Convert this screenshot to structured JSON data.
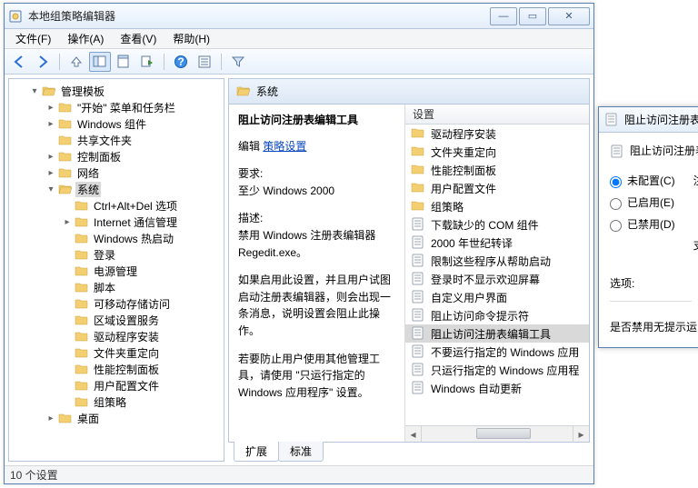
{
  "window": {
    "title": "本地组策略编辑器"
  },
  "menu": {
    "file": "文件(F)",
    "action": "操作(A)",
    "view": "查看(V)",
    "help": "帮助(H)"
  },
  "tree": [
    {
      "depth": 0,
      "toggle": "▾",
      "open": true,
      "label": "管理模板",
      "selected": false
    },
    {
      "depth": 1,
      "toggle": "▸",
      "open": false,
      "label": "\"开始\" 菜单和任务栏",
      "selected": false
    },
    {
      "depth": 1,
      "toggle": "▸",
      "open": false,
      "label": "Windows 组件",
      "selected": false
    },
    {
      "depth": 1,
      "toggle": "",
      "open": false,
      "label": "共享文件夹",
      "selected": false
    },
    {
      "depth": 1,
      "toggle": "▸",
      "open": false,
      "label": "控制面板",
      "selected": false
    },
    {
      "depth": 1,
      "toggle": "▸",
      "open": false,
      "label": "网络",
      "selected": false
    },
    {
      "depth": 1,
      "toggle": "▾",
      "open": true,
      "label": "系统",
      "selected": true
    },
    {
      "depth": 2,
      "toggle": "",
      "open": false,
      "label": "Ctrl+Alt+Del 选项",
      "selected": false
    },
    {
      "depth": 2,
      "toggle": "▸",
      "open": false,
      "label": "Internet 通信管理",
      "selected": false
    },
    {
      "depth": 2,
      "toggle": "",
      "open": false,
      "label": "Windows 热启动",
      "selected": false
    },
    {
      "depth": 2,
      "toggle": "",
      "open": false,
      "label": "登录",
      "selected": false
    },
    {
      "depth": 2,
      "toggle": "",
      "open": false,
      "label": "电源管理",
      "selected": false
    },
    {
      "depth": 2,
      "toggle": "",
      "open": false,
      "label": "脚本",
      "selected": false
    },
    {
      "depth": 2,
      "toggle": "",
      "open": false,
      "label": "可移动存储访问",
      "selected": false
    },
    {
      "depth": 2,
      "toggle": "",
      "open": false,
      "label": "区域设置服务",
      "selected": false
    },
    {
      "depth": 2,
      "toggle": "",
      "open": false,
      "label": "驱动程序安装",
      "selected": false
    },
    {
      "depth": 2,
      "toggle": "",
      "open": false,
      "label": "文件夹重定向",
      "selected": false
    },
    {
      "depth": 2,
      "toggle": "",
      "open": false,
      "label": "性能控制面板",
      "selected": false
    },
    {
      "depth": 2,
      "toggle": "",
      "open": false,
      "label": "用户配置文件",
      "selected": false
    },
    {
      "depth": 2,
      "toggle": "",
      "open": false,
      "label": "组策略",
      "selected": false
    },
    {
      "depth": 1,
      "toggle": "▸",
      "open": false,
      "label": "桌面",
      "selected": false
    }
  ],
  "right": {
    "header": "系统",
    "detail": {
      "title": "阻止访问注册表编辑工具",
      "edit_label": "编辑",
      "link": "策略设置",
      "req_label": "要求:",
      "req_value": "至少 Windows 2000",
      "desc_label": "描述:",
      "desc1": "禁用 Windows 注册表编辑器 Regedit.exe。",
      "desc2": "如果启用此设置，并且用户试图启动注册表编辑器，则会出现一条消息，说明设置会阻止此操作。",
      "desc3": "若要防止用户使用其他管理工具，请使用 \"只运行指定的 Windows 应用程序\" 设置。"
    },
    "list_header": "设置",
    "list": [
      {
        "kind": "folder",
        "label": "驱动程序安装"
      },
      {
        "kind": "folder",
        "label": "文件夹重定向"
      },
      {
        "kind": "folder",
        "label": "性能控制面板"
      },
      {
        "kind": "folder",
        "label": "用户配置文件"
      },
      {
        "kind": "folder",
        "label": "组策略"
      },
      {
        "kind": "policy",
        "label": "下载缺少的 COM 组件"
      },
      {
        "kind": "policy",
        "label": "2000 年世纪转译"
      },
      {
        "kind": "policy",
        "label": "限制这些程序从帮助启动"
      },
      {
        "kind": "policy",
        "label": "登录时不显示欢迎屏幕"
      },
      {
        "kind": "policy",
        "label": "自定义用户界面"
      },
      {
        "kind": "policy",
        "label": "阻止访问命令提示符"
      },
      {
        "kind": "policy",
        "label": "阻止访问注册表编辑工具",
        "selected": true
      },
      {
        "kind": "policy",
        "label": "不要运行指定的 Windows 应用"
      },
      {
        "kind": "policy",
        "label": "只运行指定的 Windows 应用程"
      },
      {
        "kind": "policy",
        "label": "Windows 自动更新"
      }
    ],
    "tabs": {
      "extended": "扩展",
      "standard": "标准"
    }
  },
  "status": "10 个设置",
  "dialog": {
    "title": "阻止访问注册表",
    "heading": "阻止访问注册表",
    "not_configured": "未配置(C)",
    "enabled": "已启用(E)",
    "disabled": "已禁用(D)",
    "annotation": "注",
    "support": "支",
    "options": "选项:",
    "content": "是否禁用无提示运"
  }
}
